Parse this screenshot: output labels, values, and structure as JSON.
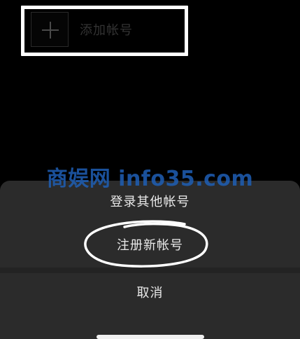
{
  "add_account": {
    "label": "添加帐号",
    "icon": "plus-icon"
  },
  "bottom_sheet": {
    "login_other": "登录其他帐号",
    "register_new": "注册新帐号",
    "cancel": "取消"
  },
  "watermark": {
    "text": "商娱网 info35.com"
  },
  "colors": {
    "background": "#000000",
    "sheet": "#2b2b2b",
    "annotation": "#ffffff",
    "watermark": "#1f5fb5"
  }
}
